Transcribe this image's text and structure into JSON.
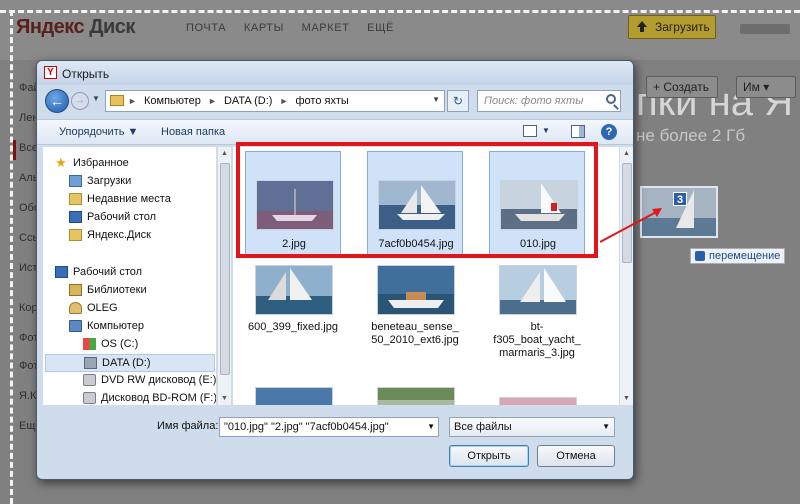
{
  "background_page": {
    "logo_brand": "Яндекс",
    "logo_product": "Диск",
    "topnav": [
      "ПОЧТА",
      "КАРТЫ",
      "МАРКЕТ",
      "ЕЩЁ"
    ],
    "upload_label": "Загрузить",
    "sidebar_items": [
      "Фай",
      "Лен",
      "Все",
      "Аль",
      "Обо",
      "Ссы",
      "Ист",
      "Кор",
      "Фот",
      "Фот",
      "Я.К",
      "Ещ"
    ],
    "button_create": "+ Создать",
    "button_sort": "Им ▾",
    "heading": "пки на Я",
    "subheading": "не более 2 Гб",
    "drag_count": "3",
    "drag_tip": "перемещение"
  },
  "dialog": {
    "title": "Открыть",
    "app_icon": "Y",
    "address_crumbs": [
      "Компьютер",
      "DATA (D:)",
      "фото яхты"
    ],
    "search_placeholder": "Поиск: фото яхты",
    "toolbar": {
      "organize": "Упорядочить ▼",
      "new_folder": "Новая папка"
    },
    "nav_items": [
      {
        "label": "Избранное",
        "icon": "star-icon"
      },
      {
        "label": "Загрузки",
        "icon": "downloads-folder-icon"
      },
      {
        "label": "Недавние места",
        "icon": "recent-places-icon"
      },
      {
        "label": "Рабочий стол",
        "icon": "desktop-icon"
      },
      {
        "label": "Яндекс.Диск",
        "icon": "folder-icon"
      },
      {
        "label": "Рабочий стол",
        "icon": "desktop-icon"
      },
      {
        "label": "Библиотеки",
        "icon": "libraries-icon"
      },
      {
        "label": "OLEG",
        "icon": "user-folder-icon"
      },
      {
        "label": "Компьютер",
        "icon": "computer-icon"
      },
      {
        "label": "OS (C:)",
        "icon": "windows-drive-icon"
      },
      {
        "label": "DATA (D:)",
        "icon": "drive-icon"
      },
      {
        "label": "DVD RW дисковод (E:)",
        "icon": "dvd-drive-icon"
      },
      {
        "label": "Дисковод BD-ROM (F:)",
        "icon": "bd-drive-icon"
      }
    ],
    "files": [
      {
        "name": "2.jpg",
        "selected": true
      },
      {
        "name": "7acf0b0454.jpg",
        "selected": true
      },
      {
        "name": "010.jpg",
        "selected": true
      },
      {
        "name": "600_399_fixed.jpg",
        "selected": false
      },
      {
        "name": "beneteau_sense_50_2010_ext6.jpg",
        "selected": false
      },
      {
        "name": "bt-f305_boat_yacht_marmaris_3.jpg",
        "selected": false
      }
    ],
    "filename_label": "Имя файла:",
    "filename_value": "\"010.jpg\" \"2.jpg\" \"7acf0b0454.jpg\"",
    "filetype_value": "Все файлы",
    "open_button": "Открыть",
    "cancel_button": "Отмена"
  },
  "colors": {
    "highlight_red": "#e0171a",
    "selection_blue": "#cfe2f8"
  }
}
